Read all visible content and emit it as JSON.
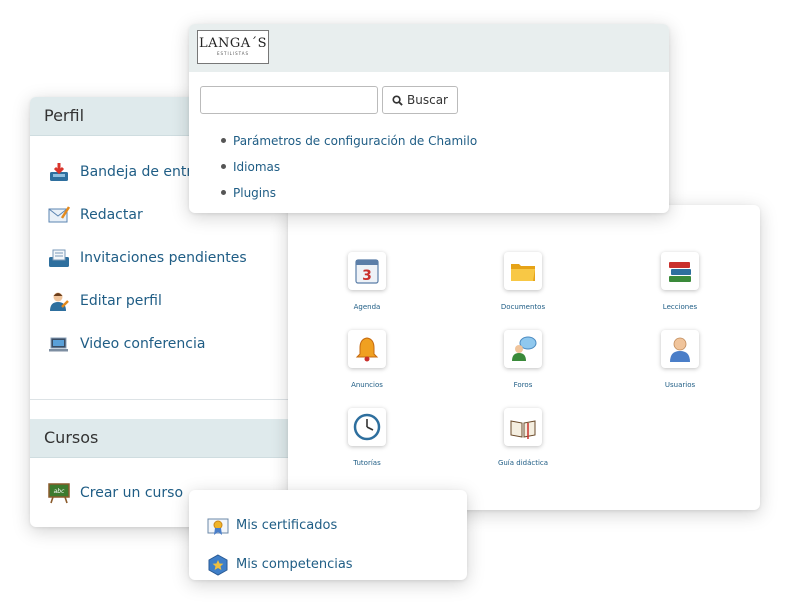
{
  "perfil": {
    "title": "Perfil",
    "items": [
      {
        "label": "Bandeja de entrada",
        "icon": "inbox-icon"
      },
      {
        "label": "Redactar",
        "icon": "compose-mail-icon"
      },
      {
        "label": "Invitaciones pendientes",
        "icon": "invitations-icon"
      },
      {
        "label": "Editar perfil",
        "icon": "edit-profile-icon"
      },
      {
        "label": "Video conferencia",
        "icon": "video-conference-icon"
      }
    ]
  },
  "cursos": {
    "title": "Cursos",
    "items": [
      {
        "label": "Crear un curso",
        "icon": "blackboard-icon"
      }
    ]
  },
  "admin": {
    "logo": {
      "name": "LANGA´S",
      "tagline": "ESTILISTAS"
    },
    "search": {
      "value": "",
      "placeholder": "",
      "button": "Buscar"
    },
    "links": [
      "Parámetros de configuración de Chamilo",
      "Idiomas",
      "Plugins"
    ]
  },
  "tools": [
    {
      "label": "Agenda",
      "icon": "calendar-icon"
    },
    {
      "label": "Documentos",
      "icon": "folder-icon"
    },
    {
      "label": "Lecciones",
      "icon": "books-icon"
    },
    {
      "label": "Anuncios",
      "icon": "bell-icon"
    },
    {
      "label": "Foros",
      "icon": "forum-icon"
    },
    {
      "label": "Usuarios",
      "icon": "user-icon"
    },
    {
      "label": "Tutorías",
      "icon": "clock-icon"
    },
    {
      "label": "Guía didáctica",
      "icon": "open-book-icon"
    }
  ],
  "skills": {
    "items": [
      {
        "label": "Mis certificados",
        "icon": "certificate-icon"
      },
      {
        "label": "Mis competencias",
        "icon": "skills-badge-icon"
      }
    ]
  },
  "colors": {
    "link": "#1f5d85",
    "header_bg": "#dfeaec",
    "admin_header_bg": "#e8eeee"
  }
}
